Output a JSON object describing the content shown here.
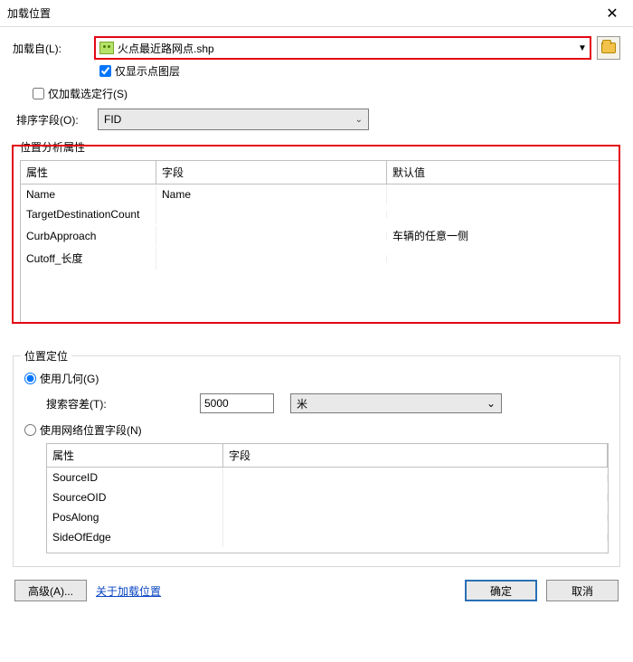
{
  "window": {
    "title": "加载位置"
  },
  "load_from": {
    "label": "加载自(L):",
    "value": "火点最近路网点.shp"
  },
  "show_point_layers": {
    "label": "仅显示点图层",
    "checked": true
  },
  "load_selected_rows": {
    "label": "仅加载选定行(S)",
    "checked": false
  },
  "sort": {
    "label": "排序字段(O):",
    "value": "FID"
  },
  "attr_section": {
    "title": "位置分析属性",
    "columns": {
      "attr": "属性",
      "field": "字段",
      "def": "默认值"
    },
    "rows": [
      {
        "attr": "Name",
        "field": "Name",
        "def": ""
      },
      {
        "attr": "TargetDestinationCount",
        "field": "",
        "def": ""
      },
      {
        "attr": "CurbApproach",
        "field": "",
        "def": "车辆的任意一侧"
      },
      {
        "attr": "Cutoff_长度",
        "field": "",
        "def": ""
      }
    ]
  },
  "locate": {
    "legend": "位置定位",
    "use_geometry": "使用几何(G)",
    "tolerance_label": "搜索容差(T):",
    "tolerance_value": "5000",
    "unit": "米",
    "use_net_fields": "使用网络位置字段(N)",
    "columns": {
      "attr": "属性",
      "field": "字段"
    },
    "rows": [
      {
        "attr": "SourceID",
        "field": ""
      },
      {
        "attr": "SourceOID",
        "field": ""
      },
      {
        "attr": "PosAlong",
        "field": ""
      },
      {
        "attr": "SideOfEdge",
        "field": ""
      }
    ]
  },
  "footer": {
    "advanced": "高级(A)...",
    "about": "关于加载位置",
    "ok": "确定",
    "cancel": "取消"
  }
}
